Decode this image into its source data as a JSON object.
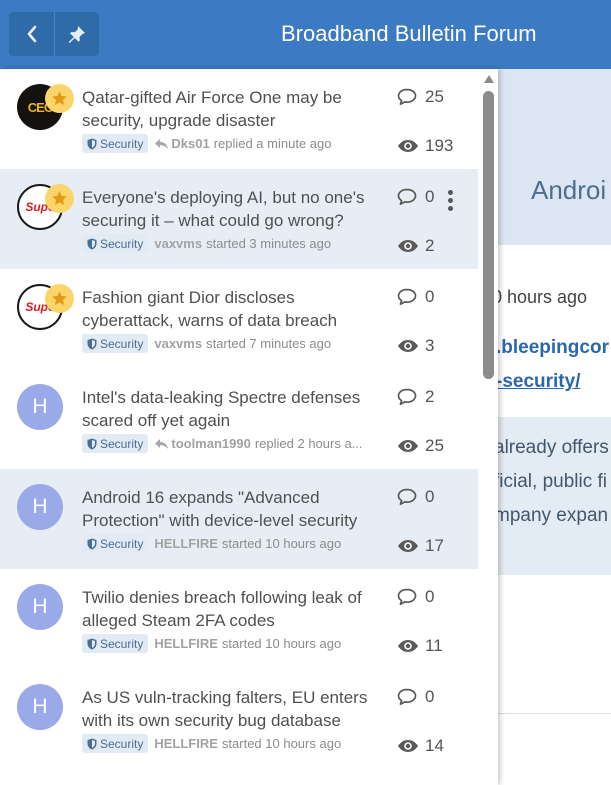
{
  "header": {
    "title": "Broadband Bulletin Forum",
    "back_icon": "chevron-left-icon",
    "pin_icon": "pin-icon"
  },
  "background_thread": {
    "title_fragment": "Androi",
    "time_fragment": "0 hours ago",
    "link_fragment_1": ".bleepingcor",
    "link_fragment_2": "-security/",
    "quote_lines": [
      "already offers",
      "ficial, public fi",
      "mpany expan"
    ]
  },
  "threads": [
    {
      "title": "Qatar-gifted Air Force One may be security, upgrade disaster",
      "avatar": "logo-a",
      "avatar_text": "CEC",
      "featured": true,
      "tag": "Security",
      "action_icon": "reply-icon",
      "user": "Dks01",
      "action": "replied a minute ago",
      "replies": "25",
      "views": "193",
      "highlighted": false,
      "menu": false
    },
    {
      "title": "Everyone's deploying AI, but no one's securing it – what could go wrong?",
      "avatar": "logo-b",
      "avatar_text": "Supe",
      "featured": true,
      "tag": "Security",
      "action_icon": "",
      "user": "vaxvms",
      "action": "started 3 minutes ago",
      "replies": "0",
      "views": "2",
      "highlighted": true,
      "menu": true
    },
    {
      "title": "Fashion giant Dior discloses cyberattack, warns of data breach",
      "avatar": "logo-b",
      "avatar_text": "Supe",
      "featured": true,
      "tag": "Security",
      "action_icon": "",
      "user": "vaxvms",
      "action": "started 7 minutes ago",
      "replies": "0",
      "views": "3",
      "highlighted": false,
      "menu": false
    },
    {
      "title": "Intel's data-leaking Spectre defenses scared off yet again",
      "avatar": "letter",
      "avatar_text": "H",
      "featured": false,
      "tag": "Security",
      "action_icon": "reply-icon",
      "user": "toolman1990",
      "action": "replied 2 hours a...",
      "replies": "2",
      "views": "25",
      "highlighted": false,
      "menu": false
    },
    {
      "title": "Android 16 expands \"Advanced Protection\" with device-level security",
      "avatar": "letter",
      "avatar_text": "H",
      "featured": false,
      "tag": "Security",
      "action_icon": "",
      "user": "HELLFIRE",
      "action": "started 10 hours ago",
      "replies": "0",
      "views": "17",
      "highlighted": true,
      "menu": false
    },
    {
      "title": "Twilio denies breach following leak of alleged Steam 2FA codes",
      "avatar": "letter",
      "avatar_text": "H",
      "featured": false,
      "tag": "Security",
      "action_icon": "",
      "user": "HELLFIRE",
      "action": "started 10 hours ago",
      "replies": "0",
      "views": "11",
      "highlighted": false,
      "menu": false
    },
    {
      "title": "As US vuln-tracking falters, EU enters with its own security bug database",
      "avatar": "letter",
      "avatar_text": "H",
      "featured": false,
      "tag": "Security",
      "action_icon": "",
      "user": "HELLFIRE",
      "action": "started 10 hours ago",
      "replies": "0",
      "views": "14",
      "highlighted": false,
      "menu": false
    }
  ],
  "scrollbar": {
    "position": 0.0
  },
  "colors": {
    "header": "#3c7bc3",
    "highlight_row": "#e6edf5",
    "letter_avatar": "#9aa9e8",
    "star": "#fbd56a"
  }
}
